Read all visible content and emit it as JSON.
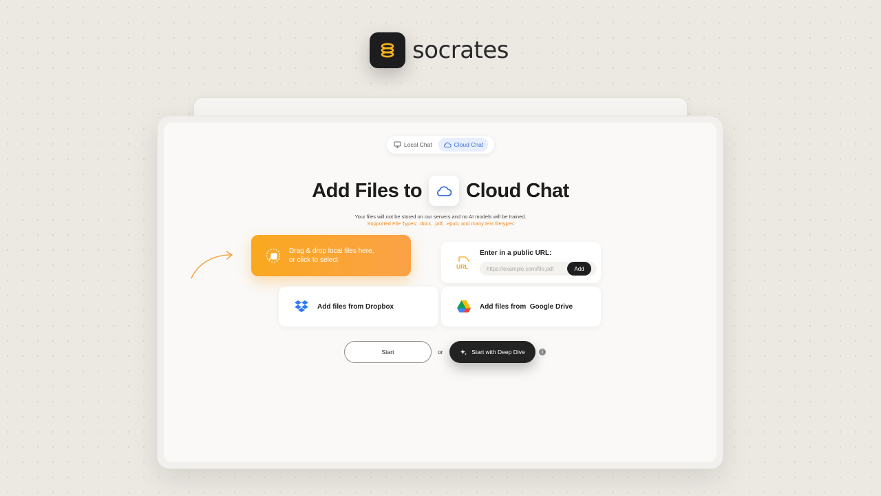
{
  "brand": {
    "name": "socrates"
  },
  "mode_toggle": {
    "local_label": "Local Chat",
    "cloud_label": "Cloud Chat",
    "active": "cloud"
  },
  "headline": {
    "prefix": "Add Files to",
    "suffix": "Cloud Chat"
  },
  "privacy_note": "Your files will not be stored on our servers and no AI models will be trained.",
  "filetypes_note": "Supported File Types: .docx, .pdf, .epub, and many text filetypes",
  "drop_zone": {
    "line1": "Drag & drop local files here,",
    "line2": "or click to select"
  },
  "url_card": {
    "icon_text": "URL",
    "title": "Enter in a public URL:",
    "placeholder": "https://example.com/file.pdf",
    "value": "",
    "add_label": "Add"
  },
  "sources": {
    "dropbox_label": "Add files from Dropbox",
    "gdrive_label": "Add files from  Google Drive"
  },
  "actions": {
    "start_label": "Start",
    "or_label": "or",
    "deep_dive_label": "Start with Deep Dive",
    "info_glyph": "i"
  },
  "colors": {
    "accent_orange": "#f9a81f",
    "cloud_blue": "#3b6fd9",
    "dark": "#232323"
  },
  "icons": [
    "coil-logo-icon",
    "monitor-icon",
    "cloud-icon",
    "upload-file-icon",
    "url-file-icon",
    "dropbox-icon",
    "google-drive-icon",
    "sparkle-icon",
    "info-icon",
    "curved-arrow-icon"
  ]
}
